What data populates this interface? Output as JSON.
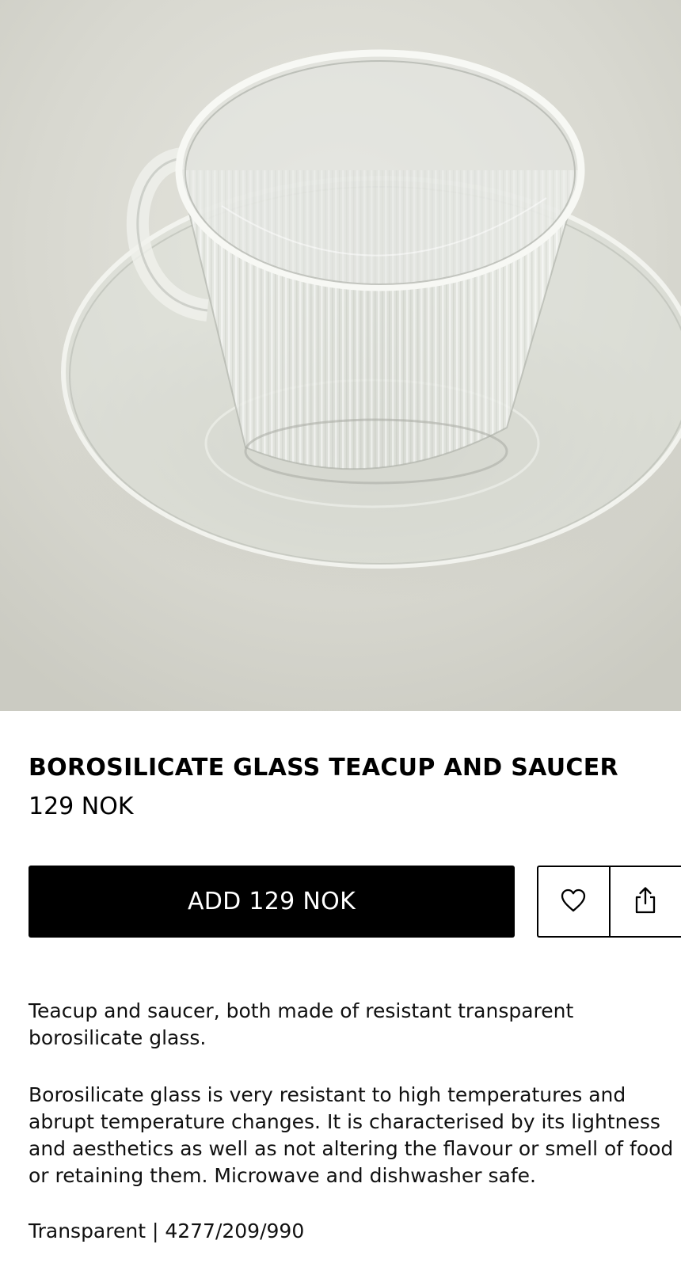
{
  "product": {
    "name": "BOROSILICATE GLASS TEACUP AND SAUCER",
    "price": "129 NOK",
    "add_button_label": "ADD 129 NOK",
    "description_1": "Teacup and saucer, both made of resistant transparent borosilicate glass.",
    "description_2": "Borosilicate glass is very resistant to high temperatures and abrupt temperature changes. It is characterised by its lightness and aesthetics as well as not altering the flavour or smell of food or retaining them. Microwave and dishwasher safe.",
    "reference": "Transparent | 4277/209/990"
  },
  "icons": {
    "favorite": "heart-icon",
    "share": "share-icon"
  },
  "colors": {
    "button_bg": "#000000",
    "button_text": "#ffffff",
    "background": "#ffffff"
  }
}
